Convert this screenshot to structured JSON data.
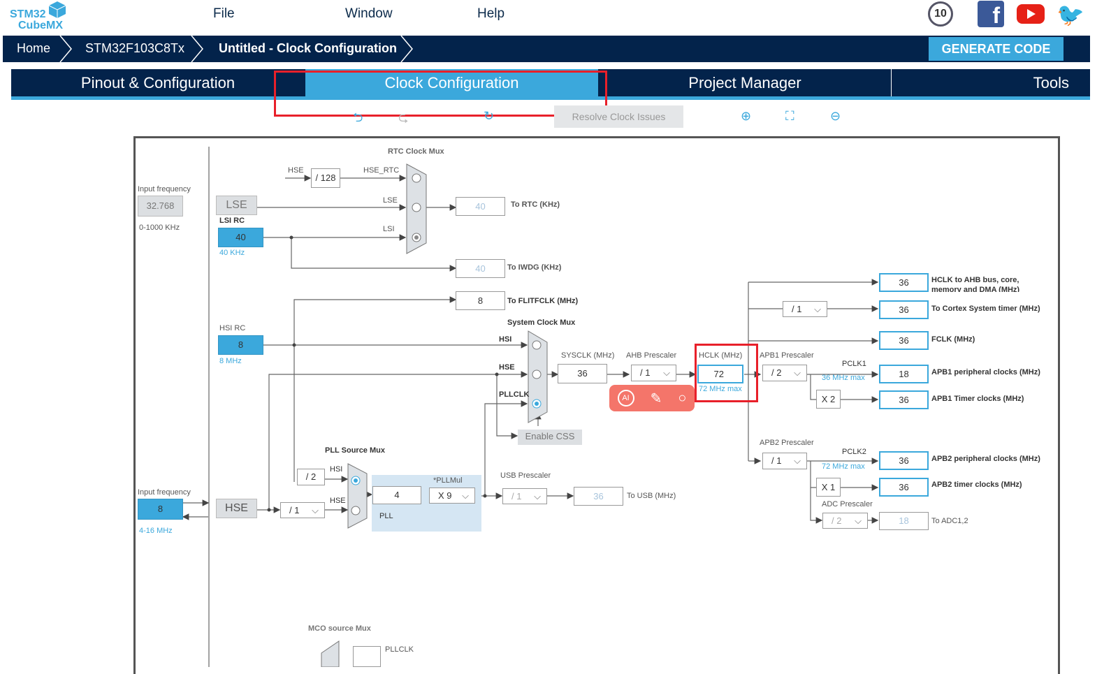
{
  "app": {
    "logo_line1": "STM32",
    "logo_line2": "CubeMX",
    "menu": [
      "File",
      "Window",
      "Help"
    ],
    "social_icons": [
      "anniversary-10-icon",
      "facebook-icon",
      "youtube-icon",
      "twitter-icon"
    ]
  },
  "breadcrumb": [
    "Home",
    "STM32F103C8Tx",
    "Untitled - Clock Configuration"
  ],
  "generate_label": "GENERATE CODE",
  "tabs": [
    {
      "label": "Pinout & Configuration"
    },
    {
      "label": "Clock Configuration",
      "active": true
    },
    {
      "label": "Project Manager"
    },
    {
      "label": "Tools"
    }
  ],
  "toolbar": {
    "resolve": "Resolve Clock Issues",
    "icons": [
      "undo-icon",
      "redo-icon",
      "refresh-icon",
      "zoom-in-icon",
      "fit-icon",
      "zoom-out-icon"
    ]
  },
  "colors": {
    "navy": "#03234b",
    "accent": "#3ba8dc",
    "highlight": "#e8202a"
  },
  "diagram": {
    "lse": {
      "input_label": "Input frequency",
      "value": "32.768",
      "range": "0-1000 KHz",
      "name": "LSE"
    },
    "lsi": {
      "name": "LSI RC",
      "value": "40",
      "unit": "40 KHz"
    },
    "rtc": {
      "title": "RTC Clock Mux",
      "hse": "HSE",
      "div": "/ 128",
      "hse_rtc": "HSE_RTC",
      "lse": "LSE",
      "lsi": "LSI",
      "out": "40",
      "out_label": "To RTC (KHz)"
    },
    "iwdg": {
      "out": "40",
      "label": "To IWDG (KHz)"
    },
    "flit": {
      "out": "8",
      "label": "To FLITFCLK (MHz)"
    },
    "hsi": {
      "name": "HSI RC",
      "value": "8",
      "unit": "8 MHz"
    },
    "sysmux": {
      "title": "System Clock Mux",
      "hsi": "HSI",
      "hse": "HSE",
      "pll": "PLLCLK",
      "css": "Enable CSS"
    },
    "sysclk": {
      "label": "SYSCLK (MHz)",
      "value": "36"
    },
    "ahb": {
      "label": "AHB Prescaler",
      "value": "/ 1"
    },
    "hclk": {
      "label": "HCLK (MHz)",
      "value": "72",
      "max": "72 MHz max"
    },
    "ai_toolbar": {
      "icons": [
        "ai-icon",
        "magic-wand-icon",
        "search-icon"
      ]
    },
    "apb1": {
      "label": "APB1 Prescaler",
      "value": "/ 2",
      "pclk": "PCLK1",
      "max": "36 MHz max",
      "mult": "X 2"
    },
    "apb2": {
      "label": "APB2 Prescaler",
      "value": "/ 1",
      "pclk": "PCLK2",
      "max": "72 MHz max",
      "mult": "X 1"
    },
    "cortex_div": "/ 1",
    "adc": {
      "label": "ADC Prescaler",
      "value": "/ 2",
      "out": "18",
      "out_label": "To ADC1,2"
    },
    "outputs": [
      {
        "value": "36",
        "label": "HCLK to AHB bus, core, memory and DMA (MHz)"
      },
      {
        "value": "36",
        "label": "To Cortex System timer (MHz)"
      },
      {
        "value": "36",
        "label": "FCLK (MHz)"
      },
      {
        "value": "18",
        "label": "APB1 peripheral clocks (MHz)"
      },
      {
        "value": "36",
        "label": "APB1 Timer clocks (MHz)"
      },
      {
        "value": "36",
        "label": "APB2 peripheral clocks (MHz)"
      },
      {
        "value": "36",
        "label": "APB2 timer clocks (MHz)"
      }
    ],
    "pllsrc": {
      "title": "PLL Source Mux",
      "div": "/ 2",
      "hsi": "HSI",
      "hse": "HSE"
    },
    "pll": {
      "label": "PLL",
      "value": "4",
      "mul_label": "*PLLMul",
      "mul": "X 9"
    },
    "usb": {
      "label": "USB Prescaler",
      "value": "/ 1",
      "out": "36",
      "out_label": "To USB (MHz)"
    },
    "hse": {
      "input_label": "Input frequency",
      "value": "8",
      "range": "4-16 MHz",
      "name": "HSE",
      "div": "/ 1"
    },
    "mco": {
      "title": "MCO source Mux",
      "pllclk": "PLLCLK"
    }
  }
}
